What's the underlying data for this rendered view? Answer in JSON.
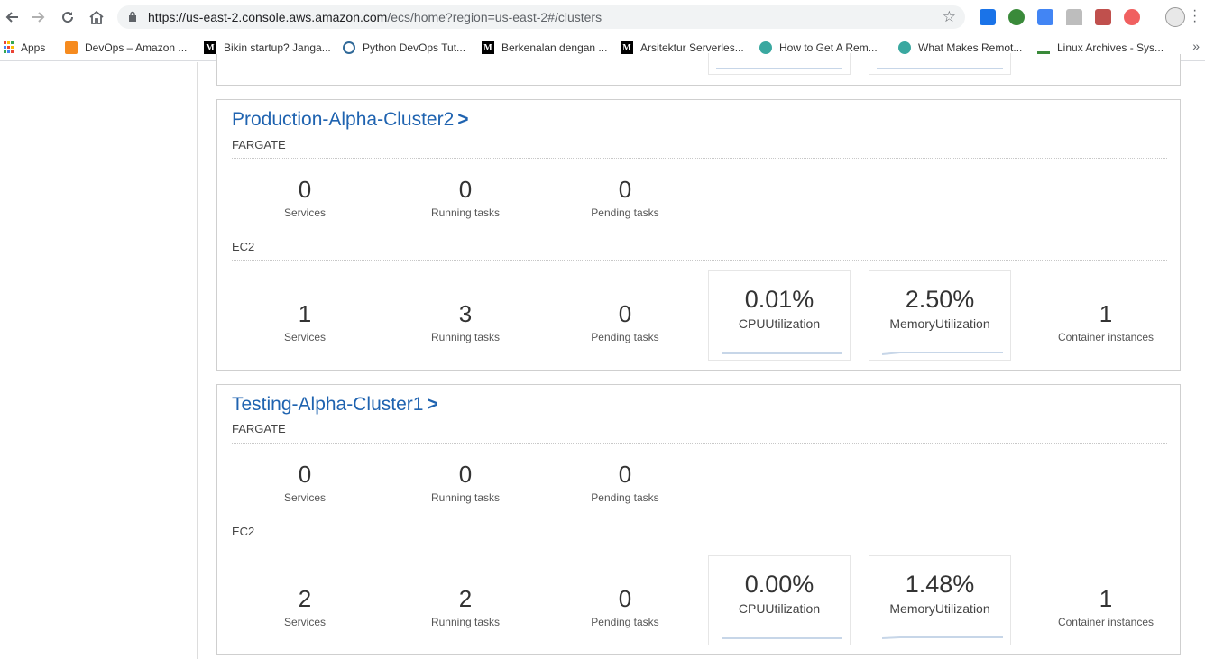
{
  "browser": {
    "url_host": "https://us-east-2.console.aws.amazon.com",
    "url_path": "/ecs/home?region=us-east-2#/clusters",
    "bookmarks": [
      {
        "label": "Apps",
        "icon": "apps-grid-icon"
      },
      {
        "label": "DevOps – Amazon ...",
        "icon": "aws-cube-icon"
      },
      {
        "label": "Bikin startup? Janga...",
        "icon": "medium-m-icon"
      },
      {
        "label": "Python DevOps Tut...",
        "icon": "python-icon"
      },
      {
        "label": "Berkenalan dengan ...",
        "icon": "medium-m-icon"
      },
      {
        "label": "Arsitektur Serverles...",
        "icon": "medium-m-icon"
      },
      {
        "label": "How to Get A Rem...",
        "icon": "remote-logo-icon"
      },
      {
        "label": "What Makes Remot...",
        "icon": "remote-logo-icon"
      },
      {
        "label": "Linux Archives - Sys...",
        "icon": "sys-logo-icon"
      }
    ],
    "more_bookmarks": "»"
  },
  "clusters": [
    {
      "name": "Production-Alpha-Cluster2",
      "chevron": ">",
      "fargate_label": "FARGATE",
      "fargate": {
        "services": "0",
        "services_label": "Services",
        "running": "0",
        "running_label": "Running tasks",
        "pending": "0",
        "pending_label": "Pending tasks"
      },
      "ec2_label": "EC2",
      "ec2": {
        "services": "1",
        "services_label": "Services",
        "running": "3",
        "running_label": "Running tasks",
        "pending": "0",
        "pending_label": "Pending tasks",
        "cpu": "0.01%",
        "cpu_label": "CPUUtilization",
        "mem": "2.50%",
        "mem_label": "MemoryUtilization",
        "instances": "1",
        "instances_label": "Container instances"
      }
    },
    {
      "name": "Testing-Alpha-Cluster1",
      "chevron": ">",
      "fargate_label": "FARGATE",
      "fargate": {
        "services": "0",
        "services_label": "Services",
        "running": "0",
        "running_label": "Running tasks",
        "pending": "0",
        "pending_label": "Pending tasks"
      },
      "ec2_label": "EC2",
      "ec2": {
        "services": "2",
        "services_label": "Services",
        "running": "2",
        "running_label": "Running tasks",
        "pending": "0",
        "pending_label": "Pending tasks",
        "cpu": "0.00%",
        "cpu_label": "CPUUtilization",
        "mem": "1.48%",
        "mem_label": "MemoryUtilization",
        "instances": "1",
        "instances_label": "Container instances"
      }
    }
  ],
  "colors": {
    "link_blue": "#1f63b0",
    "spark_line": "#c7d6e8"
  }
}
